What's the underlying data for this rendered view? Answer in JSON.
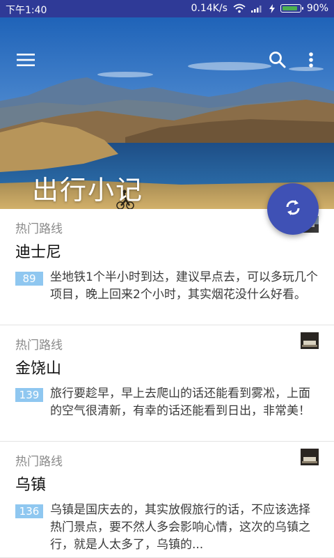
{
  "status_bar": {
    "time": "下午1:40",
    "network_speed": "0.14K/s",
    "battery_level": "90%",
    "battery_fraction": 0.9
  },
  "header": {
    "title": "出行小记",
    "icons": [
      "menu-icon",
      "search-icon",
      "more-icon"
    ]
  },
  "fab": {
    "icon": "refresh-icon",
    "color": "#3f51b5"
  },
  "cards": [
    {
      "category": "热门路线",
      "title": "迪士尼",
      "count": "89",
      "description": "坐地铁1个半小时到达，建议早点去，可以多玩几个项目，晚上回来2个小时，其实烟花没什么好看。"
    },
    {
      "category": "热门路线",
      "title": "金饶山",
      "count": "139",
      "description": "旅行要趁早，早上去爬山的话还能看到雾凇，上面的空气很清新，有幸的话还能看到日出，非常美！"
    },
    {
      "category": "热门路线",
      "title": "乌镇",
      "count": "136",
      "description": "乌镇是国庆去的，其实放假旅行的话，不应该选择热门景点，要不然人多会影响心情，这次的乌镇之行，就是人太多了，乌镇的..."
    }
  ],
  "colors": {
    "status_bar": "#2f3a97",
    "accent": "#3f51b5",
    "count_badge": "#8fc7f0"
  }
}
